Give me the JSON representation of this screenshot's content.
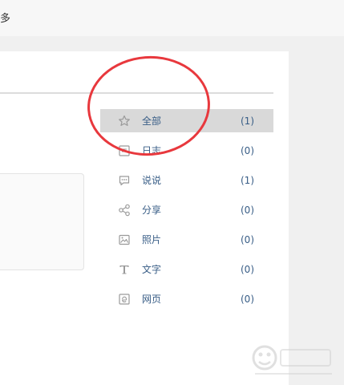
{
  "topbar": {
    "text": "多"
  },
  "sidebar": {
    "items": [
      {
        "label": "全部",
        "count": "(1)",
        "icon": "star-icon"
      },
      {
        "label": "日志",
        "count": "(0)",
        "icon": "journal-icon"
      },
      {
        "label": "说说",
        "count": "(1)",
        "icon": "speech-bubble-icon"
      },
      {
        "label": "分享",
        "count": "(0)",
        "icon": "share-icon"
      },
      {
        "label": "照片",
        "count": "(0)",
        "icon": "photo-icon"
      },
      {
        "label": "文字",
        "count": "(0)",
        "icon": "text-icon"
      },
      {
        "label": "网页",
        "count": "(0)",
        "icon": "webpage-icon"
      }
    ]
  },
  "colors": {
    "accent": "#385d86",
    "active_bg": "#d9d9d9",
    "annotation": "#e8383d"
  }
}
